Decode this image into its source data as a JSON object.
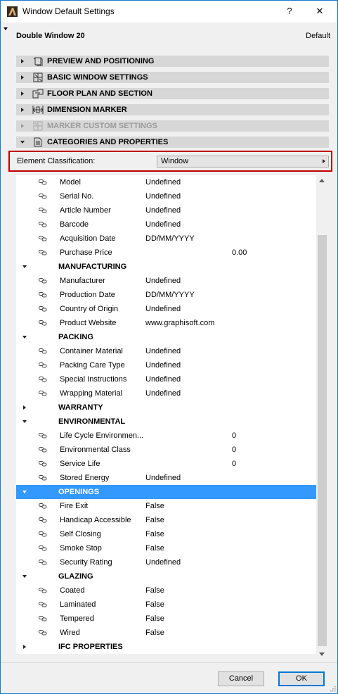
{
  "window": {
    "title": "Window Default Settings",
    "help": "?",
    "close": "✕"
  },
  "header": {
    "doc_title": "Double Window 20",
    "default_label": "Default"
  },
  "sections": [
    {
      "label": "PREVIEW AND POSITIONING",
      "icon": "preview-icon",
      "expanded": false,
      "disabled": false
    },
    {
      "label": "BASIC WINDOW SETTINGS",
      "icon": "window-settings-icon",
      "expanded": false,
      "disabled": false
    },
    {
      "label": "FLOOR PLAN AND SECTION",
      "icon": "floor-plan-icon",
      "expanded": false,
      "disabled": false
    },
    {
      "label": "DIMENSION MARKER",
      "icon": "dimension-marker-icon",
      "expanded": false,
      "disabled": false
    },
    {
      "label": "MARKER CUSTOM SETTINGS",
      "icon": "marker-custom-icon",
      "expanded": false,
      "disabled": true
    },
    {
      "label": "CATEGORIES AND PROPERTIES",
      "icon": "categories-icon",
      "expanded": true,
      "disabled": false
    }
  ],
  "classification": {
    "label": "Element Classification:",
    "value": "Window"
  },
  "properties": [
    {
      "type": "prop",
      "name": "Model",
      "value": "Undefined"
    },
    {
      "type": "prop",
      "name": "Serial No.",
      "value": "Undefined"
    },
    {
      "type": "prop",
      "name": "Article Number",
      "value": "Undefined"
    },
    {
      "type": "prop",
      "name": "Barcode",
      "value": "Undefined"
    },
    {
      "type": "prop",
      "name": "Acquisition Date",
      "value": "DD/MM/YYYY"
    },
    {
      "type": "prop",
      "name": "Purchase Price",
      "value": "0.00",
      "numeric": true
    },
    {
      "type": "group",
      "name": "MANUFACTURING",
      "expanded": true
    },
    {
      "type": "prop",
      "name": "Manufacturer",
      "value": "Undefined"
    },
    {
      "type": "prop",
      "name": "Production Date",
      "value": "DD/MM/YYYY"
    },
    {
      "type": "prop",
      "name": "Country of Origin",
      "value": "Undefined"
    },
    {
      "type": "prop",
      "name": "Product Website",
      "value": "www.graphisoft.com"
    },
    {
      "type": "group",
      "name": "PACKING",
      "expanded": true
    },
    {
      "type": "prop",
      "name": "Container Material",
      "value": "Undefined"
    },
    {
      "type": "prop",
      "name": "Packing Care Type",
      "value": "Undefined"
    },
    {
      "type": "prop",
      "name": "Special Instructions",
      "value": "Undefined"
    },
    {
      "type": "prop",
      "name": "Wrapping Material",
      "value": "Undefined"
    },
    {
      "type": "group",
      "name": "WARRANTY",
      "expanded": false
    },
    {
      "type": "group",
      "name": "ENVIRONMENTAL",
      "expanded": true
    },
    {
      "type": "prop",
      "name": "Life Cycle Environmen...",
      "value": "0",
      "numeric": true
    },
    {
      "type": "prop",
      "name": "Environmental Class",
      "value": "0",
      "numeric": true
    },
    {
      "type": "prop",
      "name": "Service Life",
      "value": "0",
      "numeric": true
    },
    {
      "type": "prop",
      "name": "Stored Energy",
      "value": "Undefined"
    },
    {
      "type": "group",
      "name": "OPENINGS",
      "expanded": true,
      "selected": true
    },
    {
      "type": "prop",
      "name": "Fire Exit",
      "value": "False"
    },
    {
      "type": "prop",
      "name": "Handicap Accessible",
      "value": "False"
    },
    {
      "type": "prop",
      "name": "Self Closing",
      "value": "False"
    },
    {
      "type": "prop",
      "name": "Smoke Stop",
      "value": "False"
    },
    {
      "type": "prop",
      "name": "Security Rating",
      "value": "Undefined"
    },
    {
      "type": "group",
      "name": "GLAZING",
      "expanded": true
    },
    {
      "type": "prop",
      "name": "Coated",
      "value": "False"
    },
    {
      "type": "prop",
      "name": "Laminated",
      "value": "False"
    },
    {
      "type": "prop",
      "name": "Tempered",
      "value": "False"
    },
    {
      "type": "prop",
      "name": "Wired",
      "value": "False"
    },
    {
      "type": "group",
      "name": "IFC PROPERTIES",
      "expanded": false
    }
  ],
  "buttons": {
    "cancel": "Cancel",
    "ok": "OK"
  },
  "colors": {
    "selection": "#3399ff",
    "highlight_border": "#c00000",
    "window_border": "#1979ca"
  }
}
